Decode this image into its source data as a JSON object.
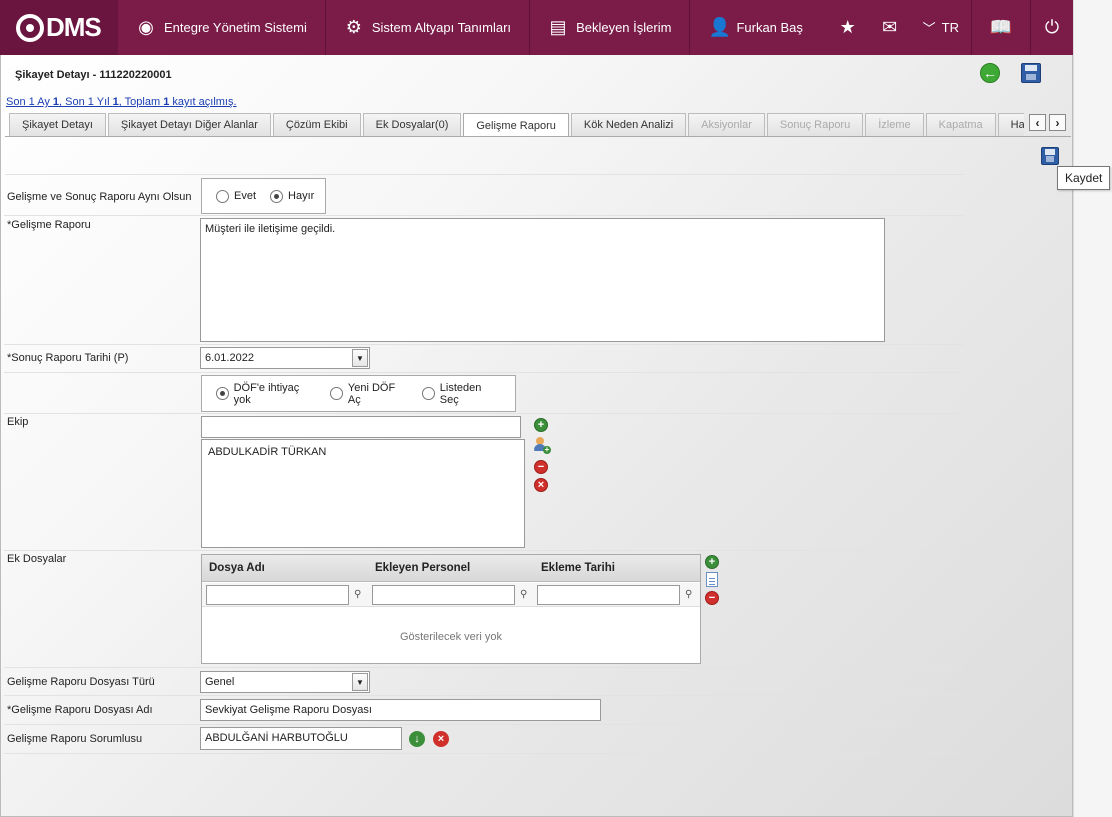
{
  "topbar": {
    "logo_text": "DMS",
    "nav": [
      {
        "label": "Entegre Yönetim Sistemi",
        "icon": "qdms-q-icon"
      },
      {
        "label": "Sistem Altyapı Tanımları",
        "icon": "gear-icon"
      },
      {
        "label": "Bekleyen İşlerim",
        "icon": "clipboard-icon"
      },
      {
        "label": "Furkan Baş",
        "icon": "user-icon"
      }
    ],
    "language": "TR"
  },
  "page": {
    "title": "Şikayet Detayı - 111220220001",
    "info": {
      "p1": "Son 1 Ay ",
      "n1": "1",
      "p2": ", Son 1 Yıl ",
      "n2": "1",
      "p3": ", Toplam ",
      "n3": "1",
      "p4": " kayıt açılmış."
    }
  },
  "tabs": [
    {
      "label": "Şikayet Detayı",
      "state": "normal"
    },
    {
      "label": "Şikayet Detayı Diğer Alanlar",
      "state": "normal"
    },
    {
      "label": "Çözüm Ekibi",
      "state": "normal"
    },
    {
      "label": "Ek Dosyalar(0)",
      "state": "normal"
    },
    {
      "label": "Gelişme Raporu",
      "state": "active"
    },
    {
      "label": "Kök Neden Analizi",
      "state": "normal"
    },
    {
      "label": "Aksiyonlar",
      "state": "disabled"
    },
    {
      "label": "Sonuç Raporu",
      "state": "disabled"
    },
    {
      "label": "İzleme",
      "state": "disabled"
    },
    {
      "label": "Kapatma",
      "state": "disabled"
    },
    {
      "label": "Hata Dağ",
      "state": "normal"
    }
  ],
  "tooltip": "Kaydet",
  "form": {
    "same_report": {
      "label": "Gelişme ve Sonuç Raporu Aynı Olsun",
      "options": [
        "Evet",
        "Hayır"
      ],
      "selected": "Hayır"
    },
    "progress_report": {
      "label": "*Gelişme Raporu",
      "value": "Müşteri ile iletişime geçildi."
    },
    "result_date": {
      "label": "*Sonuç Raporu Tarihi (P)",
      "value": "6.01.2022"
    },
    "dof": {
      "options": [
        "DÖF'e ihtiyaç yok",
        "Yeni DÖF Aç",
        "Listeden Seç"
      ],
      "selected": "DÖF'e ihtiyaç yok"
    },
    "team": {
      "label": "Ekip",
      "input_value": "",
      "members": [
        "ABDULKADİR TÜRKAN"
      ]
    },
    "attachments": {
      "label": "Ek Dosyalar",
      "columns": [
        "Dosya Adı",
        "Ekleyen Personel",
        "Ekleme Tarihi"
      ],
      "empty_text": "Gösterilecek veri yok"
    },
    "file_type": {
      "label": "Gelişme Raporu Dosyası Türü",
      "value": "Genel"
    },
    "file_name": {
      "label": "*Gelişme Raporu Dosyası Adı",
      "value": "Sevkiyat Gelişme Raporu Dosyası"
    },
    "responsible": {
      "label": "Gelişme Raporu Sorumlusu",
      "value": "ABDULĞANİ HARBUTOĞLU"
    }
  }
}
